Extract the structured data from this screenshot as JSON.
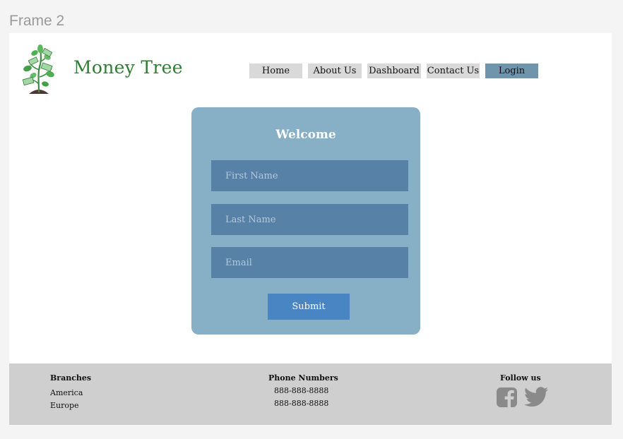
{
  "frame": {
    "label": "Frame 2"
  },
  "header": {
    "brand": "Money Tree",
    "nav": [
      {
        "label": "Home"
      },
      {
        "label": "About Us"
      },
      {
        "label": "Dashboard"
      },
      {
        "label": "Contact Us"
      },
      {
        "label": "Login"
      }
    ]
  },
  "form": {
    "title": "Welcome",
    "first_name_placeholder": "First Name",
    "last_name_placeholder": "Last Name",
    "email_placeholder": "Email",
    "submit_label": "Submit"
  },
  "footer": {
    "branches": {
      "heading": "Branches",
      "items": [
        "America",
        "Europe"
      ]
    },
    "phones": {
      "heading": "Phone Numbers",
      "items": [
        "888-888-8888",
        "888-888-8888"
      ]
    },
    "social": {
      "heading": "Follow us",
      "icons": [
        "facebook-icon",
        "twitter-icon"
      ]
    }
  },
  "colors": {
    "brand_green": "#2e7d32",
    "card_bg": "#87afc6",
    "field_bg": "#5781a6",
    "submit_bg": "#4a85c3",
    "login_bg": "#6f95ad",
    "footer_bg": "#cfcfcf"
  }
}
